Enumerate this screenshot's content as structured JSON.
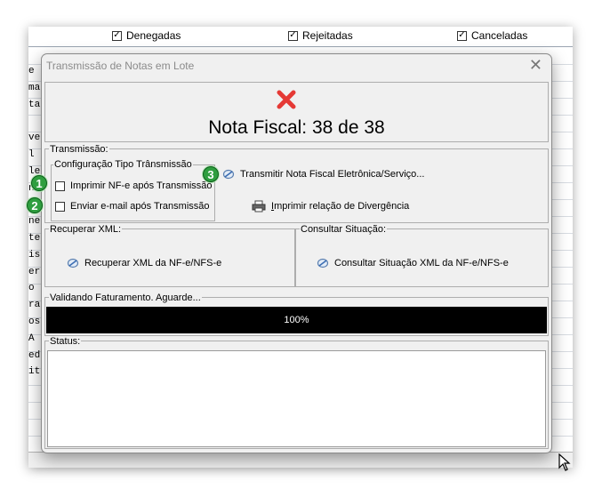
{
  "background_window": {
    "filters": [
      {
        "label": "Denegadas",
        "checked": true
      },
      {
        "label": "Rejeitadas",
        "checked": true
      },
      {
        "label": "Canceladas",
        "checked": true
      }
    ],
    "row_fragments": [
      "e",
      "man",
      "ta",
      "",
      "ver",
      "l",
      "le",
      "ns",
      "",
      "ne",
      "te",
      "is",
      "er",
      "o",
      "ra",
      "os",
      "A",
      "ed",
      "it"
    ]
  },
  "dialog": {
    "title": "Transmissão de Notas em Lote",
    "header": {
      "status_icon": "red-x-icon",
      "nota_fiscal_text": "Nota Fiscal: 38 de 38"
    },
    "transmissao": {
      "legend": "Transmissão:",
      "config": {
        "legend": "Configuração Tipo Trânsmissão",
        "options": [
          {
            "badge": "1",
            "label": "Imprimir NF-e após Transmissão",
            "checked": false
          },
          {
            "badge": "2",
            "label": "Enviar e-mail após Transmissão",
            "checked": false
          }
        ]
      },
      "transmit_badge": "3",
      "transmit_label": "Transmitir Nota Fiscal Eletrônica/Serviço...",
      "print_div_first_letter": "I",
      "print_div_rest": "mprimir relação de Divergência"
    },
    "recuperar": {
      "legend": "Recuperar XML:",
      "button_label": "Recuperar XML da NF-e/NFS-e"
    },
    "consultar": {
      "legend": "Consultar Situação:",
      "button_label": "Consultar Situação XML da NF-e/NFS-e"
    },
    "progress": {
      "legend": "Validando Faturamento. Aguarde...",
      "value_percent": 100,
      "label": "100%"
    },
    "status": {
      "legend": "Status:",
      "text": ""
    }
  },
  "colors": {
    "error_red": "#e53935",
    "badge_green": "#2f9e3f",
    "progress_bar": "#000000"
  }
}
